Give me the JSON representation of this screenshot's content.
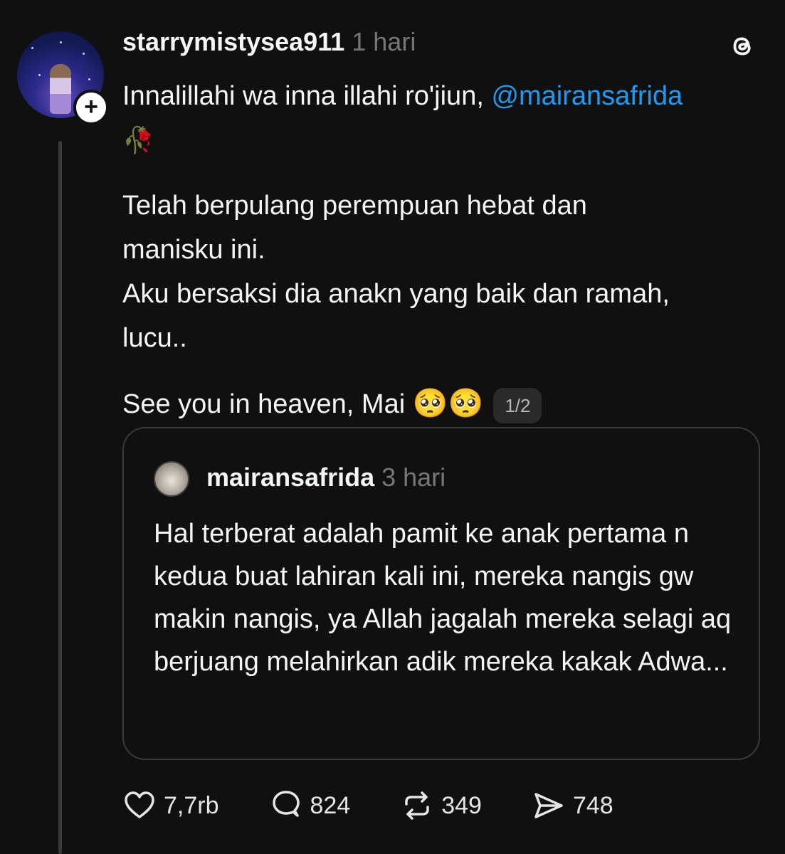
{
  "post": {
    "username": "starrymistysea911",
    "time": "1 hari",
    "line1": "Innalillahi wa inna illahi ro'jiun, ",
    "mention": "@mairansafrida",
    "rose_emoji": "🥀",
    "para2_line1": "Telah berpulang perempuan hebat dan",
    "para2_line2": "manisku ini.",
    "para3_line1": "Aku bersaksi dia anakn yang baik dan ramah,",
    "para3_line2": "lucu..",
    "last_line": "See you in heaven, Mai ",
    "last_emojis": "🥺🥺",
    "pager": "1/2"
  },
  "quote": {
    "username": "mairansafrida",
    "time": "3 hari",
    "text": "Hal terberat adalah pamit ke anak pertama n kedua buat lahiran kali ini, mereka nangis gw makin nangis, ya Allah jagalah mereka selagi aq berjuang melahirkan adik mereka kakak Adwa..."
  },
  "actions": {
    "likes": "7,7rb",
    "replies": "824",
    "reposts": "349",
    "shares": "748"
  },
  "icons": {
    "app_logo": "threads-icon",
    "follow": "plus-icon",
    "like": "heart-icon",
    "reply": "comment-icon",
    "repost": "repost-icon",
    "share": "send-icon"
  },
  "colors": {
    "background": "#101010",
    "text": "#f3f5f7",
    "muted": "#777777",
    "mention": "#1d9bf0",
    "border": "#3a3a3a"
  }
}
